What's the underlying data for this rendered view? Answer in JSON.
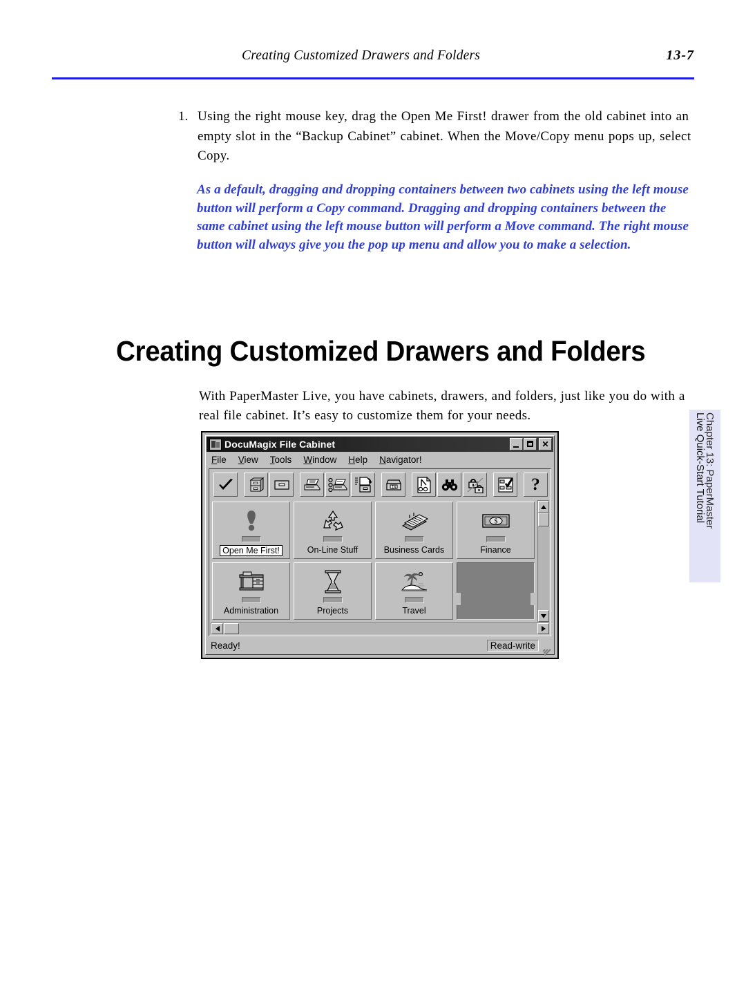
{
  "header": {
    "title": "Creating Customized Drawers and Folders",
    "page_number": "13-7",
    "rule_color": "#1a1ae0"
  },
  "step": {
    "number": "1.",
    "text": "Using the right mouse key, drag the Open Me First! drawer from the old cabinet into an empty slot in the “Backup Cabinet” cabinet. When the Move/Copy menu pops up, select Copy."
  },
  "note": {
    "text": "As a default, dragging and dropping containers between two cabinets using the left mouse button will perform a Copy command. Dragging and dropping containers between the same cabinet using the left mouse button will perform a Move command. The right mouse button will always give you the pop up menu and allow you to make a selection.",
    "color": "#2f3fd6"
  },
  "section": {
    "heading": "Creating Customized Drawers and Folders",
    "intro": "With PaperMaster Live, you have cabinets, drawers, and folders, just like you do with a real file cabinet. It’s easy to customize them for your needs."
  },
  "side_tab": {
    "line1": "Chapter 13: PaperMaster",
    "line2": "Live Quick-Start Tutorial",
    "background": "#e3e3f8"
  },
  "app_window": {
    "title": "DocuMagix File Cabinet",
    "title_icon": "documagix-app-icon",
    "title_buttons": [
      {
        "name": "minimize-button",
        "glyph": ""
      },
      {
        "name": "maximize-button",
        "glyph": ""
      },
      {
        "name": "close-button",
        "glyph": "✕"
      }
    ],
    "menu": [
      {
        "label": "File",
        "mnemonic": "F"
      },
      {
        "label": "View",
        "mnemonic": "V"
      },
      {
        "label": "Tools",
        "mnemonic": "T"
      },
      {
        "label": "Window",
        "mnemonic": "W"
      },
      {
        "label": "Help",
        "mnemonic": "H"
      },
      {
        "label": "Navigator!",
        "mnemonic": "N"
      }
    ],
    "toolbar": [
      {
        "name": "select-check-button",
        "icon": "checkmark-icon"
      },
      {
        "name": "new-cabinet-button",
        "icon": "file-cabinet-icon"
      },
      {
        "name": "new-drawer-button",
        "icon": "drawer-icon"
      },
      {
        "name": "scan-button",
        "icon": "scanner-icon"
      },
      {
        "name": "scan-settings-button",
        "icon": "scanner-settings-icon"
      },
      {
        "name": "file-document-button",
        "icon": "document-to-drawer-icon"
      },
      {
        "name": "inbox-button",
        "icon": "inbox-tray-icon"
      },
      {
        "name": "annotate-button",
        "icon": "annotate-document-icon"
      },
      {
        "name": "find-button",
        "icon": "binoculars-icon"
      },
      {
        "name": "lock-unlock-button",
        "icon": "lock-unlock-icon"
      },
      {
        "name": "checklist-button",
        "icon": "checklist-icon"
      },
      {
        "name": "help-button",
        "icon": "question-mark-icon",
        "glyph": "?"
      }
    ],
    "drawers": [
      {
        "label": "Open Me First!",
        "icon": "exclamation-mark-icon",
        "selected": true,
        "empty": false
      },
      {
        "label": "On-Line Stuff",
        "icon": "recycle-icon",
        "selected": false,
        "empty": false
      },
      {
        "label": "Business Cards",
        "icon": "rolodex-icon",
        "selected": false,
        "empty": false
      },
      {
        "label": "Finance",
        "icon": "dollar-bill-icon",
        "selected": false,
        "empty": false
      },
      {
        "label": "Administration",
        "icon": "desk-icon",
        "selected": false,
        "empty": false
      },
      {
        "label": "Projects",
        "icon": "hourglass-icon",
        "selected": false,
        "empty": false
      },
      {
        "label": "Travel",
        "icon": "palm-tree-icon",
        "selected": false,
        "empty": false
      },
      {
        "label": "",
        "icon": "empty-slot",
        "selected": false,
        "empty": true
      }
    ],
    "status": {
      "message": "Ready!",
      "mode": "Read-write"
    }
  }
}
